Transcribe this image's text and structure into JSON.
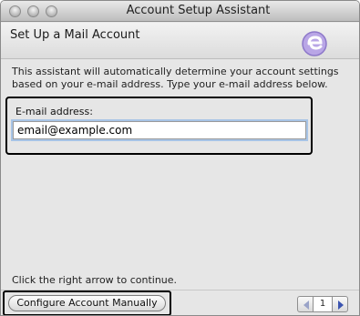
{
  "window": {
    "title": "Account Setup Assistant"
  },
  "header": {
    "heading": "Set Up a Mail Account",
    "logo": "entourage-logo-icon"
  },
  "intro": {
    "text": "This assistant will automatically determine your account settings based on your e-mail address. Type your e-mail address below."
  },
  "email": {
    "label": "E-mail address:",
    "value": "email@example.com"
  },
  "hint": {
    "text": "Click the right arrow to continue."
  },
  "footer": {
    "manual_button": "Configure Account Manually",
    "page_number": "1"
  },
  "colors": {
    "accent": "#6a5acd",
    "arrow_active": "#3b54b0",
    "arrow_disabled": "#9aa3c8"
  }
}
